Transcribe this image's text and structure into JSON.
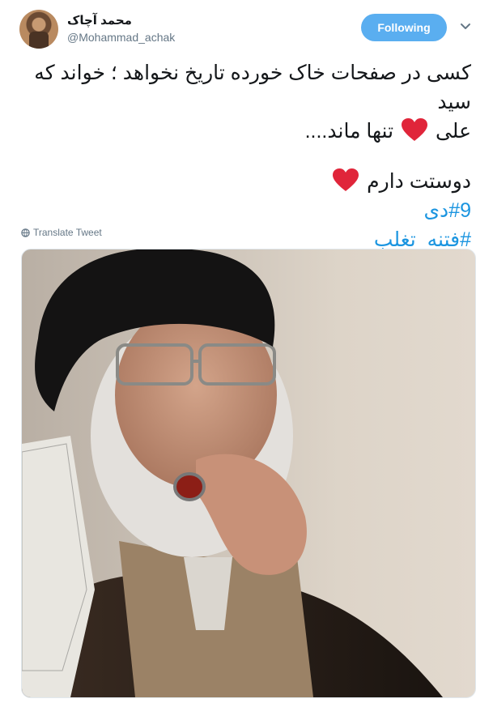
{
  "tweet": {
    "display_name": "محمد آچاک",
    "handle": "@Mohammad_achak",
    "follow_label": "Following",
    "line1": "کسی در صفحات خاک خورده تاریخ نخواهد ؛ خواند  که سید",
    "line2_start": "علی",
    "line2_end": "تنها ماند....",
    "line3": "دوستت دارم",
    "hashtag1": "#9دی",
    "hashtag2": "#فتنه_تغلب",
    "translate_label": "Translate Tweet"
  },
  "icons": {
    "heart": "red-heart-emoji",
    "globe": "globe-icon",
    "caret": "chevron-down-icon"
  },
  "colors": {
    "follow_button": "#5aaef0",
    "hashtag": "#1b95e0",
    "heart": "#e0253a",
    "secondary_text": "#657786"
  }
}
